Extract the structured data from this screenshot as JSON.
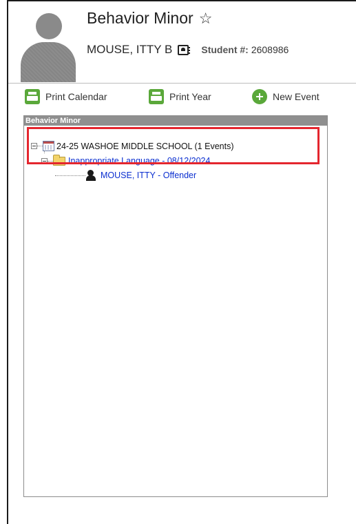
{
  "header": {
    "title": "Behavior Minor",
    "student_name": "MOUSE, ITTY B",
    "student_number_label": "Student #:",
    "student_number_value": "2608986"
  },
  "toolbar": {
    "print_calendar_label": "Print Calendar",
    "print_year_label": "Print Year",
    "new_event_label": "New Event"
  },
  "panel": {
    "header": "Behavior Minor"
  },
  "tree": {
    "school": "24-25 WASHOE MIDDLE SCHOOL (1 Events)",
    "event": "Inappropriate Language - 08/12/2024",
    "participant": "MOUSE, ITTY - Offender"
  },
  "colors": {
    "accent_green": "#5aa83a",
    "link_blue": "#0b2fd0",
    "highlight_red": "#e4262e"
  },
  "icons": [
    "avatar-placeholder",
    "star-outline-icon",
    "contact-card-icon",
    "printer-icon",
    "plus-circle-icon",
    "calendar-icon",
    "folder-icon",
    "person-icon"
  ]
}
